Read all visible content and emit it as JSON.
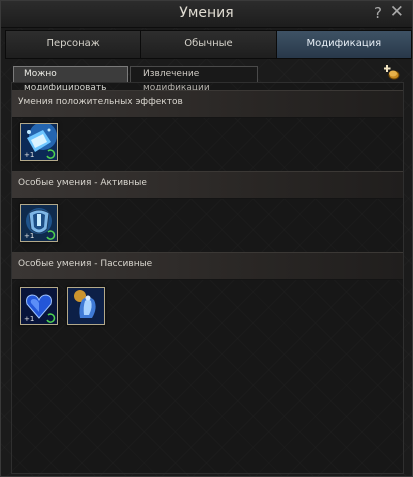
{
  "window": {
    "title": "Умения",
    "help_glyph": "?",
    "close_glyph": "✕"
  },
  "main_tabs": [
    {
      "label": "Персонаж",
      "active": false
    },
    {
      "label": "Обычные",
      "active": false
    },
    {
      "label": "Модификация",
      "active": true
    }
  ],
  "sub_tabs": [
    {
      "label": "Можно модифицировать",
      "active": true
    },
    {
      "label": "Извлечение модификации",
      "active": false
    }
  ],
  "icons": {
    "coin": "coins-plus-icon"
  },
  "sections": [
    {
      "label": "Умения положительных эффектов",
      "skills": [
        "blue-book-skill-icon"
      ]
    },
    {
      "label": "Особые умения - Активные",
      "skills": [
        "blue-armor-skill-icon"
      ]
    },
    {
      "label": "Особые умения - Пассивные",
      "skills": [
        "blue-heart-skill-icon",
        "blue-spirit-skill-icon"
      ]
    }
  ],
  "colors": {
    "active_tab": "#34475a",
    "skill_frame": "#b3a98a"
  }
}
